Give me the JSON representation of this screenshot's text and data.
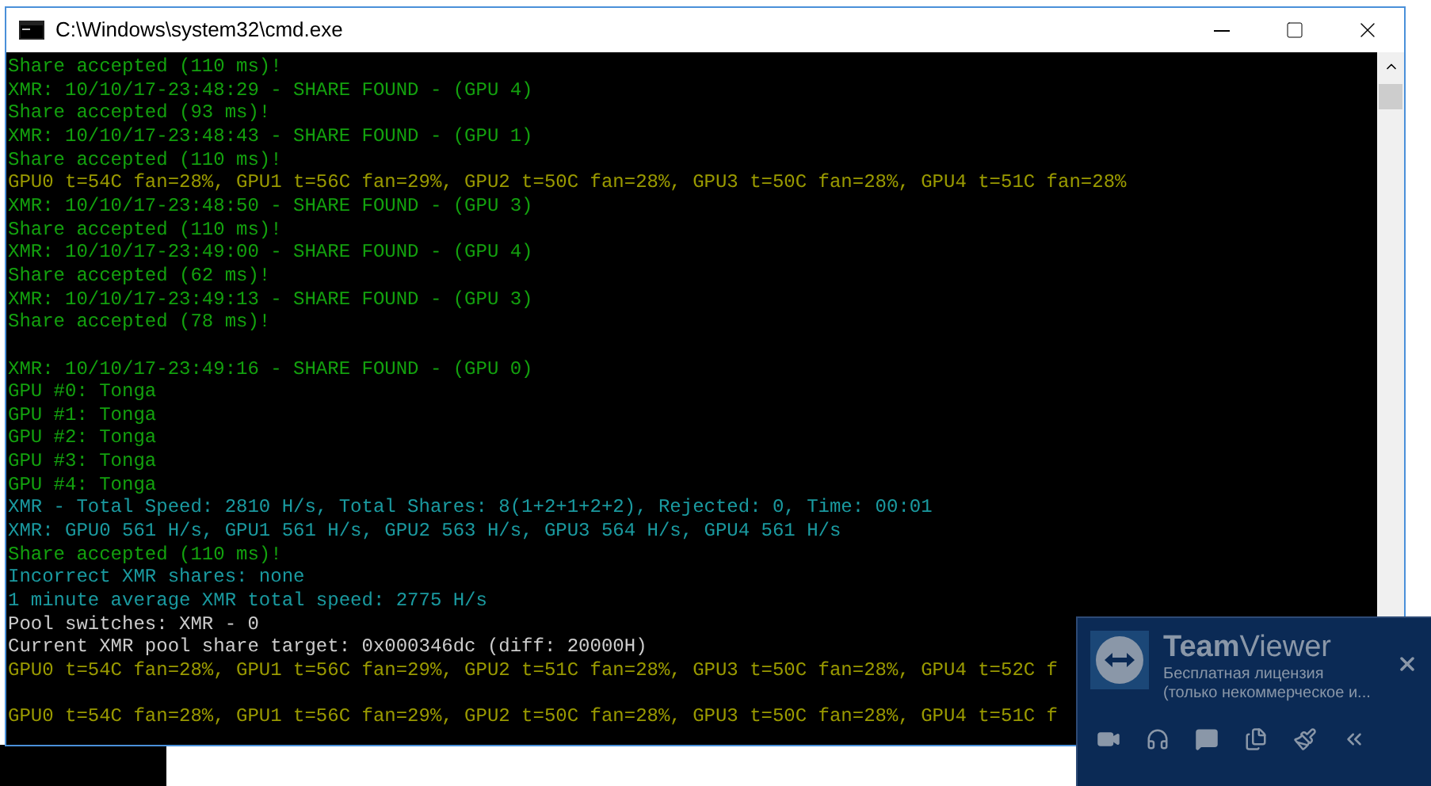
{
  "window": {
    "title": "C:\\Windows\\system32\\cmd.exe"
  },
  "console_lines": [
    {
      "text": "Share accepted (110 ms)!",
      "kind": "share"
    },
    {
      "text": "XMR: 10/10/17-23:48:29 - SHARE FOUND - (GPU 4)",
      "kind": "share"
    },
    {
      "text": "Share accepted (93 ms)!",
      "kind": "share"
    },
    {
      "text": "XMR: 10/10/17-23:48:43 - SHARE FOUND - (GPU 1)",
      "kind": "share"
    },
    {
      "text": "Share accepted (110 ms)!",
      "kind": "share"
    },
    {
      "text": "GPU0 t=54C fan=28%, GPU1 t=56C fan=29%, GPU2 t=50C fan=28%, GPU3 t=50C fan=28%, GPU4 t=51C fan=28%",
      "kind": "temperature"
    },
    {
      "text": "XMR: 10/10/17-23:48:50 - SHARE FOUND - (GPU 3)",
      "kind": "share"
    },
    {
      "text": "Share accepted (110 ms)!",
      "kind": "share"
    },
    {
      "text": "XMR: 10/10/17-23:49:00 - SHARE FOUND - (GPU 4)",
      "kind": "share"
    },
    {
      "text": "Share accepted (62 ms)!",
      "kind": "share"
    },
    {
      "text": "XMR: 10/10/17-23:49:13 - SHARE FOUND - (GPU 3)",
      "kind": "share"
    },
    {
      "text": "Share accepted (78 ms)!",
      "kind": "share"
    },
    {
      "kind": "blank"
    },
    {
      "text": "XMR: 10/10/17-23:49:16 - SHARE FOUND - (GPU 0)",
      "kind": "share"
    },
    {
      "text": "GPU #0: Tonga",
      "kind": "share"
    },
    {
      "text": "GPU #1: Tonga",
      "kind": "share"
    },
    {
      "text": "GPU #2: Tonga",
      "kind": "share"
    },
    {
      "text": "GPU #3: Tonga",
      "kind": "share"
    },
    {
      "text": "GPU #4: Tonga",
      "kind": "share"
    },
    {
      "text": "XMR - Total Speed: 2810 H/s, Total Shares: 8(1+2+1+2+2), Rejected: 0, Time: 00:01",
      "kind": "stats"
    },
    {
      "text": "XMR: GPU0 561 H/s, GPU1 561 H/s, GPU2 563 H/s, GPU3 564 H/s, GPU4 561 H/s",
      "kind": "stats"
    },
    {
      "text": "Share accepted (110 ms)!",
      "kind": "share"
    },
    {
      "text": "Incorrect XMR shares: none",
      "kind": "stats"
    },
    {
      "text": "1 minute average XMR total speed: 2775 H/s",
      "kind": "stats"
    },
    {
      "text": "Pool switches: XMR - 0",
      "kind": "pool"
    },
    {
      "text": "Current XMR pool share target: 0x000346dc (diff: 20000H)",
      "kind": "pool"
    },
    {
      "text": "GPU0 t=54C fan=28%, GPU1 t=56C fan=29%, GPU2 t=51C fan=28%, GPU3 t=50C fan=28%, GPU4 t=52C f",
      "kind": "temperature"
    },
    {
      "kind": "blank"
    },
    {
      "text": "GPU0 t=54C fan=28%, GPU1 t=56C fan=29%, GPU2 t=50C fan=28%, GPU3 t=50C fan=28%, GPU4 t=51C f",
      "kind": "temperature"
    }
  ],
  "teamviewer": {
    "title": "**Team**Viewer",
    "line_1": "Бесплатная лицензия",
    "line_2": "(только некоммерческое и..."
  }
}
